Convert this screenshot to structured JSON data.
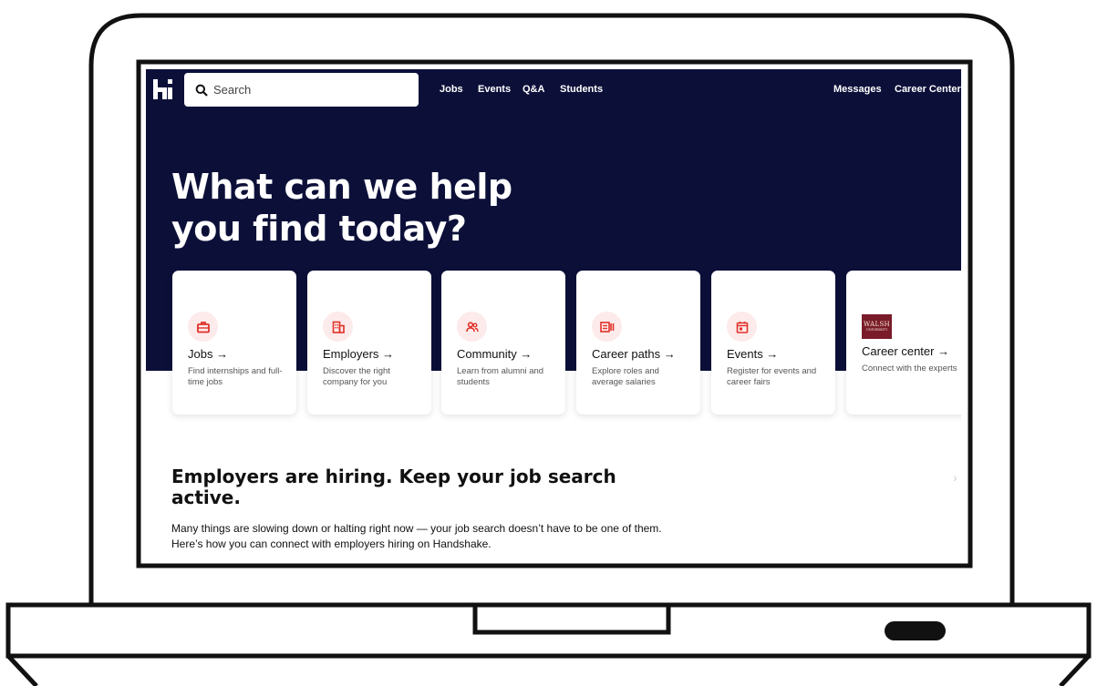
{
  "nav": {
    "search_placeholder": "Search",
    "links": [
      "Jobs",
      "Events",
      "Q&A",
      "Students"
    ],
    "right_links": [
      "Messages",
      "Career Center"
    ]
  },
  "hero": {
    "headline_line1": "What can we help",
    "headline_line2": "you find today?"
  },
  "cards": [
    {
      "title": "Jobs →",
      "desc": "Find internships and full-time jobs",
      "icon": "briefcase-icon"
    },
    {
      "title": "Employers →",
      "desc": "Discover the right company for you",
      "icon": "building-icon"
    },
    {
      "title": "Community →",
      "desc": "Learn from alumni and students",
      "icon": "people-icon"
    },
    {
      "title": "Career paths →",
      "desc": "Explore roles and average salaries",
      "icon": "career-paths-icon"
    },
    {
      "title": "Events →",
      "desc": "Register for events and career fairs",
      "icon": "calendar-icon"
    },
    {
      "title": "Career center →",
      "desc": "Connect with the experts",
      "icon": "walsh-university-logo",
      "logo_text": "WALSH",
      "logo_sub": "UNIVERSITY"
    }
  ],
  "section": {
    "heading": "Employers are hiring. Keep your job search active.",
    "body": "Many things are slowing down or halting right now — your job search doesn’t have to be one of them. Here’s how you can connect with employers hiring on Handshake."
  },
  "colors": {
    "hero_bg": "#0c1039",
    "accent": "#e0322a",
    "icon_bg": "#fdeaea",
    "logo_bg": "#7a1b2a"
  }
}
